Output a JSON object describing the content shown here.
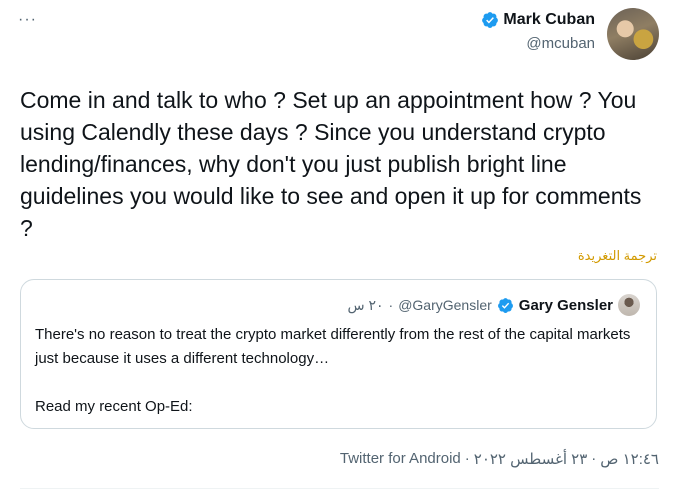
{
  "tweet": {
    "more_label": "···",
    "author": {
      "display_name": "Mark Cuban",
      "handle": "@mcuban",
      "verified": true
    },
    "text": "Come in and talk to who ? Set up an appointment how ? You using Calendly these days ? Since you understand crypto lending/finances, why don't you just publish bright line guidelines you would like to see and open it up for comments ?",
    "translate_label": "ترجمة التغريدة",
    "quoted": {
      "display_name": "Gary Gensler",
      "handle": "@GaryGensler",
      "separator": "·",
      "time": "٢٠ س",
      "verified": true,
      "line1": "There's no reason to treat the crypto market differently from the rest of the capital markets just because it uses a different technology…",
      "line2": "Read my recent Op-Ed:"
    },
    "meta": {
      "time": "١٢:٤٦ ص",
      "date": "٢٣ أغسطس ٢٠٢٢",
      "separator": "·",
      "source": "Twitter for Android"
    }
  },
  "colors": {
    "verified": "#1d9bf0",
    "text": "#0f1419",
    "secondary": "#536471",
    "translate": "#d29a00",
    "border": "#cfd9de"
  }
}
